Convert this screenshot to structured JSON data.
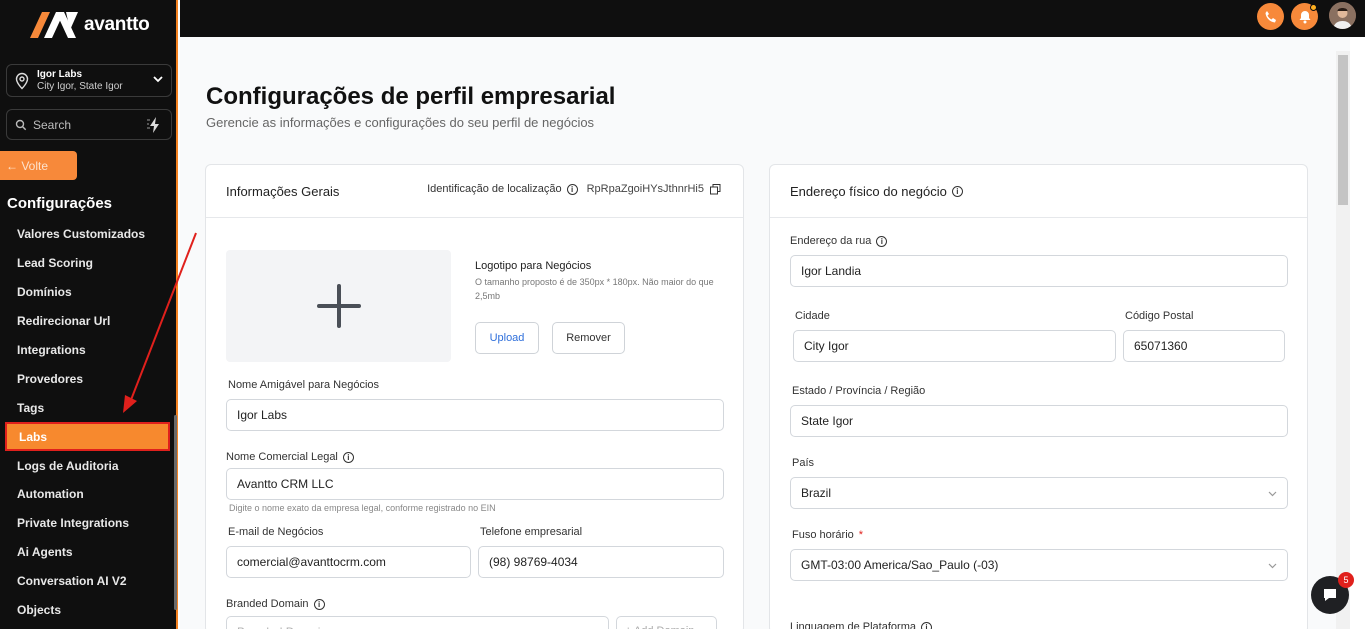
{
  "brand": {
    "name": "avantto",
    "accent": "#f7893a"
  },
  "location": {
    "name": "Igor Labs",
    "sub": "City Igor, State Igor"
  },
  "search": {
    "placeholder": "Search"
  },
  "back_label": "← Volte",
  "sidebar": {
    "section_title": "Configurações",
    "items": [
      {
        "label": "Valores Customizados"
      },
      {
        "label": "Lead Scoring"
      },
      {
        "label": "Domínios"
      },
      {
        "label": "Redirecionar Url"
      },
      {
        "label": "Integrations"
      },
      {
        "label": "Provedores"
      },
      {
        "label": "Tags"
      },
      {
        "label": "Labs"
      },
      {
        "label": "Logs de Auditoria"
      },
      {
        "label": "Automation"
      },
      {
        "label": "Private Integrations"
      },
      {
        "label": "Ai Agents"
      },
      {
        "label": "Conversation AI V2"
      },
      {
        "label": "Objects"
      }
    ],
    "active_index": 7
  },
  "topbar": {
    "icons": [
      "phone-icon",
      "bell-icon",
      "user-avatar"
    ]
  },
  "page": {
    "title": "Configurações de perfil empresarial",
    "subtitle": "Gerencie as informações e configurações do seu perfil de negócios"
  },
  "general": {
    "title": "Informações Gerais",
    "loc_id_label": "Identificação de localização",
    "loc_id_value": "RpRpaZgoiHYsJthnrHi5",
    "logo_label": "Logotipo para Negócios",
    "logo_hint": "O tamanho proposto é de 350px * 180px. Não maior do que 2,5mb",
    "upload_label": "Upload",
    "remove_label": "Remover",
    "friendly_name_label": "Nome Amigável para Negócios",
    "friendly_name_value": "Igor Labs",
    "legal_name_label": "Nome Comercial Legal",
    "legal_name_value": "Avantto CRM LLC",
    "legal_name_hint": "Digite o nome exato da empresa legal, conforme registrado no EIN",
    "email_label": "E-mail de Negócios",
    "email_value": "comercial@avanttocrm.com",
    "phone_label": "Telefone empresarial",
    "phone_value": "(98) 98769-4034",
    "branded_domain_label": "Branded Domain",
    "branded_domain_placeholder": "Branded Domain",
    "add_domain_label": "+ Add Domain"
  },
  "address": {
    "title": "Endereço físico do negócio",
    "street_label": "Endereço da rua",
    "street_value": "Igor Landia",
    "city_label": "Cidade",
    "city_value": "City Igor",
    "postal_label": "Código Postal",
    "postal_value": "65071360",
    "state_label": "Estado / Província / Região",
    "state_value": "State Igor",
    "country_label": "País",
    "country_value": "Brazil",
    "timezone_label": "Fuso horário",
    "timezone_required": "*",
    "timezone_value": "GMT-03:00 America/Sao_Paulo (-03)",
    "platform_language_label": "Linguagem de Plataforma"
  },
  "chat": {
    "badge_count": "5"
  }
}
